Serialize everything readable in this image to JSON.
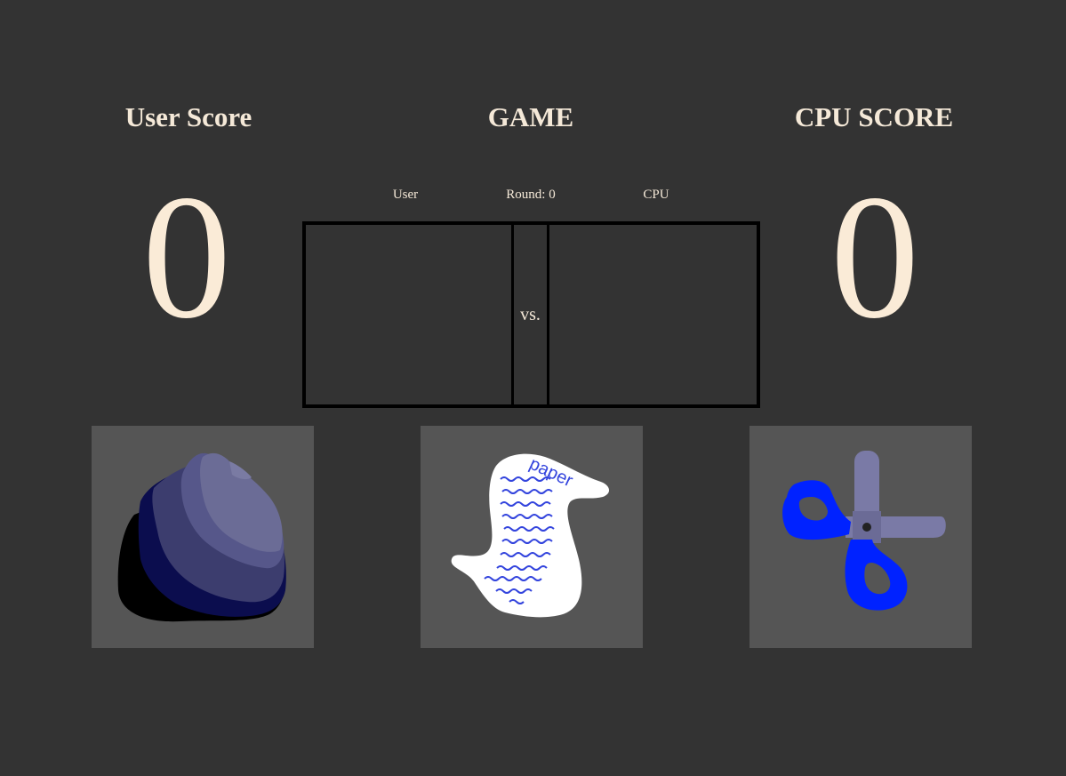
{
  "headings": {
    "user": "User Score",
    "game": "GAME",
    "cpu": "CPU SCORE"
  },
  "scores": {
    "user": "0",
    "cpu": "0"
  },
  "arena": {
    "user_label": "User",
    "round_label": "Round: 0",
    "cpu_label": "CPU",
    "vs": "vs."
  },
  "choices": [
    {
      "name": "rock",
      "icon": "rock-icon"
    },
    {
      "name": "paper",
      "icon": "paper-icon",
      "icon_text": "paper"
    },
    {
      "name": "scissors",
      "icon": "scissors-icon"
    }
  ],
  "colors": {
    "background": "#333333",
    "text": "#f5e9d8",
    "tile": "#555555",
    "border": "#000000",
    "scissors_handle": "#0022ff",
    "scissors_blade": "#7a7aa6"
  }
}
